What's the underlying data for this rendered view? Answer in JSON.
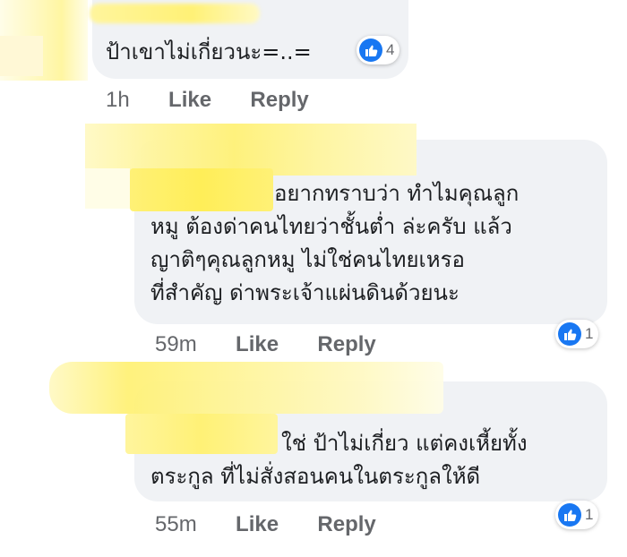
{
  "comments": [
    {
      "text_lines": [
        "ป้าเขาไม่เกี่ยวนะ=..="
      ],
      "time": "1h",
      "like_label": "Like",
      "reply_label": "Reply",
      "reaction_count": "4"
    },
    {
      "text_lines": [
        "อยากทราบว่า ทำไมคุณลูก",
        "หมู ต้องด่าคนไทยว่าชั้นต่ำ ล่ะครับ แล้ว",
        "ญาติๆคุณลูกหมู ไม่ใช่คนไทยเหรอ",
        "ที่สำคัญ ด่าพระเจ้าแผ่นดินด้วยนะ"
      ],
      "time": "59m",
      "like_label": "Like",
      "reply_label": "Reply",
      "reaction_count": "1"
    },
    {
      "text_lines": [
        "ใช่ ป้าไม่เกี่ยว แต่คงเหี้ยทั้ง",
        "ตระกูล ที่ไม่สั่งสอนคนในตระกูลให้ดี"
      ],
      "time": "55m",
      "like_label": "Like",
      "reply_label": "Reply",
      "reaction_count": "1"
    }
  ],
  "colors": {
    "bubble": "#f0f2f5",
    "meta_text": "#65676b",
    "like_blue": "#1877f2",
    "redaction_yellow": "#fff176"
  }
}
